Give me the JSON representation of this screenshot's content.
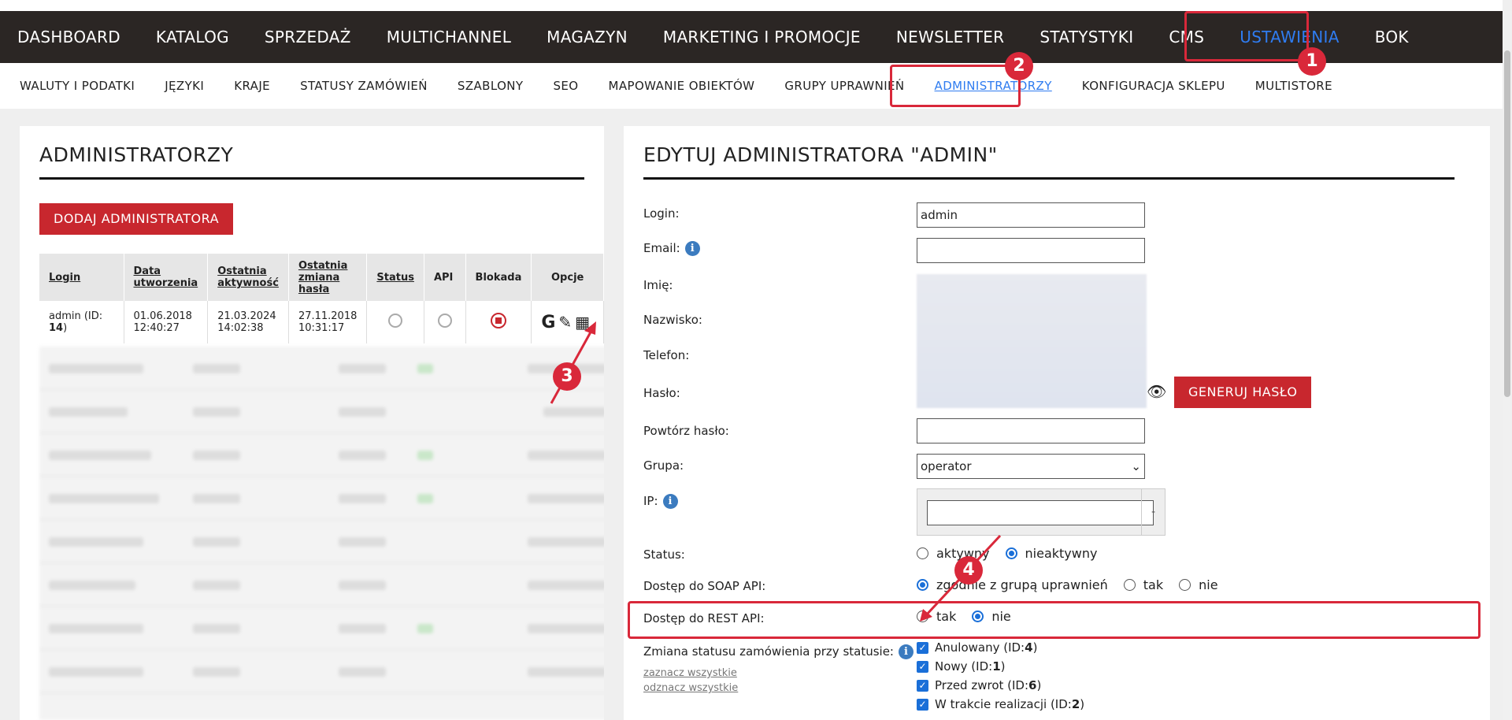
{
  "main_nav": {
    "items": [
      "DASHBOARD",
      "KATALOG",
      "SPRZEDAŻ",
      "MULTICHANNEL",
      "MAGAZYN",
      "MARKETING I PROMOCJE",
      "NEWSLETTER",
      "STATYSTYKI",
      "CMS",
      "USTAWIENIA",
      "BOK"
    ],
    "active": "USTAWIENIA"
  },
  "sub_nav": {
    "items": [
      "WALUTY I PODATKI",
      "JĘZYKI",
      "KRAJE",
      "STATUSY ZAMÓWIEŃ",
      "SZABLONY",
      "SEO",
      "MAPOWANIE OBIEKTÓW",
      "GRUPY UPRAWNIEŃ",
      "ADMINISTRATORZY",
      "KONFIGURACJA SKLEPU",
      "MULTISTORE"
    ],
    "active": "ADMINISTRATORZY"
  },
  "left": {
    "title": "ADMINISTRATORZY",
    "add_button": "DODAJ ADMINISTRATORA",
    "columns": [
      "Login",
      "Data utworzenia",
      "Ostatnia aktywność",
      "Ostatnia zmiana hasła",
      "Status",
      "API",
      "Blokada",
      "Opcje"
    ],
    "row": {
      "login": "admin (ID: ",
      "login_id": "14",
      "login_suffix": ")",
      "created_date": "01.06.2018",
      "created_time": "12:40:27",
      "last_active_date": "21.03.2024",
      "last_active_time": "14:02:38",
      "pwd_change_date": "27.11.2018",
      "pwd_change_time": "10:31:17"
    }
  },
  "right": {
    "title": "EDYTUJ ADMINISTRATORA \"ADMIN\"",
    "labels": {
      "login": "Login:",
      "email": "Email:",
      "first_name": "Imię:",
      "last_name": "Nazwisko:",
      "phone": "Telefon:",
      "password": "Hasło:",
      "repeat_password": "Powtórz hasło:",
      "group": "Grupa:",
      "ip": "IP:",
      "status": "Status:",
      "soap_api": "Dostęp do SOAP API:",
      "rest_api": "Dostęp do REST API:",
      "order_status_change": "Zmiana statusu zamówienia przy statusie:"
    },
    "login_value": "admin",
    "generate_password": "GENERUJ HASŁO",
    "group_value": "operator",
    "ip_dash": "-",
    "status_options": [
      "aktywny",
      "nieaktywny"
    ],
    "status_selected": "nieaktywny",
    "soap_options": [
      "zgodnie z grupą uprawnień",
      "tak",
      "nie"
    ],
    "soap_selected": "zgodnie z grupą uprawnień",
    "rest_options": [
      "tak",
      "nie"
    ],
    "rest_selected": "nie",
    "select_all": "zaznacz wszystkie",
    "deselect_all": "odznacz wszystkie",
    "order_statuses": [
      {
        "name": "Anulowany (ID: ",
        "id": "4",
        "suffix": ")"
      },
      {
        "name": "Nowy (ID: ",
        "id": "1",
        "suffix": ")"
      },
      {
        "name": "Przed zwrot (ID: ",
        "id": "6",
        "suffix": ")"
      },
      {
        "name": "W trakcie realizacji (ID: ",
        "id": "2",
        "suffix": ")"
      }
    ]
  },
  "callouts": [
    "1",
    "2",
    "3",
    "4"
  ],
  "colors": {
    "accent_red": "#c8272e",
    "annotation_red": "#d9283a",
    "active_blue": "#2f7cf0",
    "nav_bg": "#2b2624"
  }
}
